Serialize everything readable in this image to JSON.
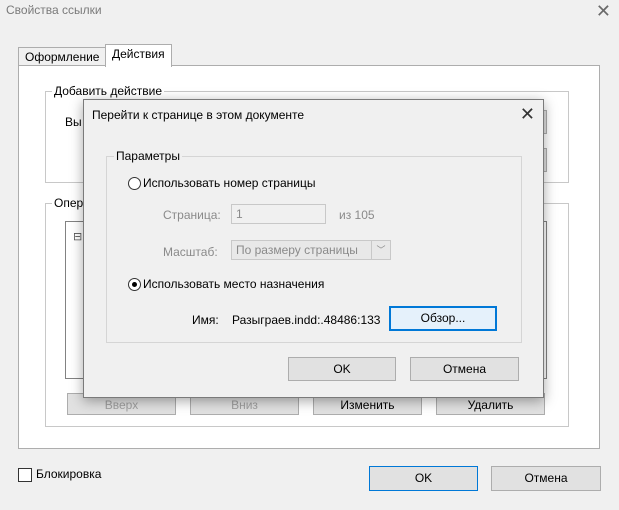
{
  "window": {
    "title": "Свойства ссылки",
    "close_glyph": "✕"
  },
  "tabs": [
    {
      "label": "Оформление"
    },
    {
      "label": "Действия"
    }
  ],
  "actions_panel": {
    "add_action_group": "Добавить действие",
    "add_action_label_partial": "Вы",
    "operations_group_partial": "Опер",
    "tree_expander": "⊟",
    "buttons": {
      "up": "Вверх",
      "down": "Вниз",
      "edit": "Изменить",
      "delete": "Удалить"
    }
  },
  "footer": {
    "lock_label": "Блокировка",
    "ok": "OK",
    "cancel": "Отмена"
  },
  "modal": {
    "title": "Перейти к странице в этом документе",
    "close_glyph": "✕",
    "params_group": "Параметры",
    "use_page_number": "Использовать номер страницы",
    "page_label": "Страница:",
    "page_value": "1",
    "page_of": "из 105",
    "zoom_label": "Масштаб:",
    "zoom_value": "По размеру страницы",
    "use_destination": "Использовать место назначения",
    "name_label": "Имя:",
    "name_value": "Разыграев.indd:.48486:133",
    "browse": "Обзор...",
    "ok": "OK",
    "cancel": "Отмена"
  }
}
